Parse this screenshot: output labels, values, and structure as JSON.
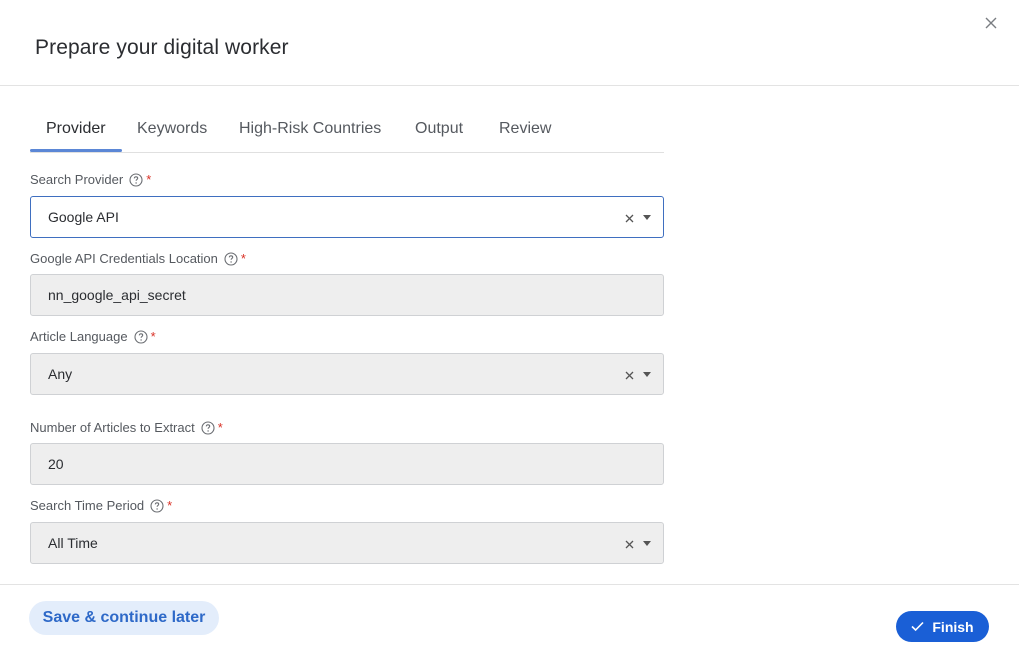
{
  "dialog": {
    "title": "Prepare your digital worker",
    "close_icon": "close-icon"
  },
  "tabs": [
    {
      "label": "Provider",
      "active": true
    },
    {
      "label": "Keywords",
      "active": false
    },
    {
      "label": "High-Risk Countries",
      "active": false
    },
    {
      "label": "Output",
      "active": false
    },
    {
      "label": "Review",
      "active": false
    }
  ],
  "form": {
    "search_provider": {
      "label": "Search Provider",
      "required": "*",
      "value": "Google API",
      "help_icon": "help-circle-icon"
    },
    "credentials_location": {
      "label": "Google API Credentials Location",
      "required": "*",
      "value": "nn_google_api_secret",
      "help_icon": "help-circle-icon"
    },
    "article_language": {
      "label": "Article Language",
      "required": "*",
      "value": "Any",
      "help_icon": "help-circle-icon"
    },
    "num_articles": {
      "label": "Number of Articles to Extract",
      "required": "*",
      "value": "20",
      "help_icon": "help-circle-icon"
    },
    "time_period": {
      "label": "Search Time Period",
      "required": "*",
      "value": "All Time",
      "help_icon": "help-circle-icon"
    }
  },
  "footer": {
    "save_label": "Save & continue later",
    "finish_label": "Finish",
    "finish_icon": "check-icon"
  },
  "colors": {
    "accent": "#1a5fd6",
    "tab_underline": "#5b87d6",
    "required": "#d93025",
    "save_bg": "#e3edfb"
  }
}
